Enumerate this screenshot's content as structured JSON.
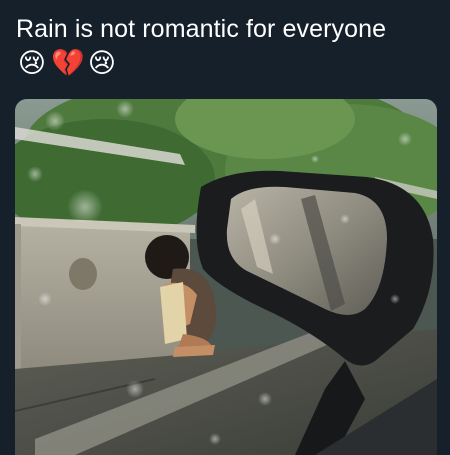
{
  "post": {
    "caption": "Rain is not romantic for everyone",
    "emojis": [
      {
        "name": "crying-face-emoji",
        "glyph": "😢"
      },
      {
        "name": "broken-heart-emoji",
        "glyph": "💔"
      },
      {
        "name": "crying-face-emoji",
        "glyph": "😢"
      }
    ],
    "photo": {
      "subject": "child sitting by a roadside wall in the rain, seen through a car window with side mirror"
    }
  },
  "colors": {
    "background": "#15202b",
    "text": "#ffffff"
  }
}
